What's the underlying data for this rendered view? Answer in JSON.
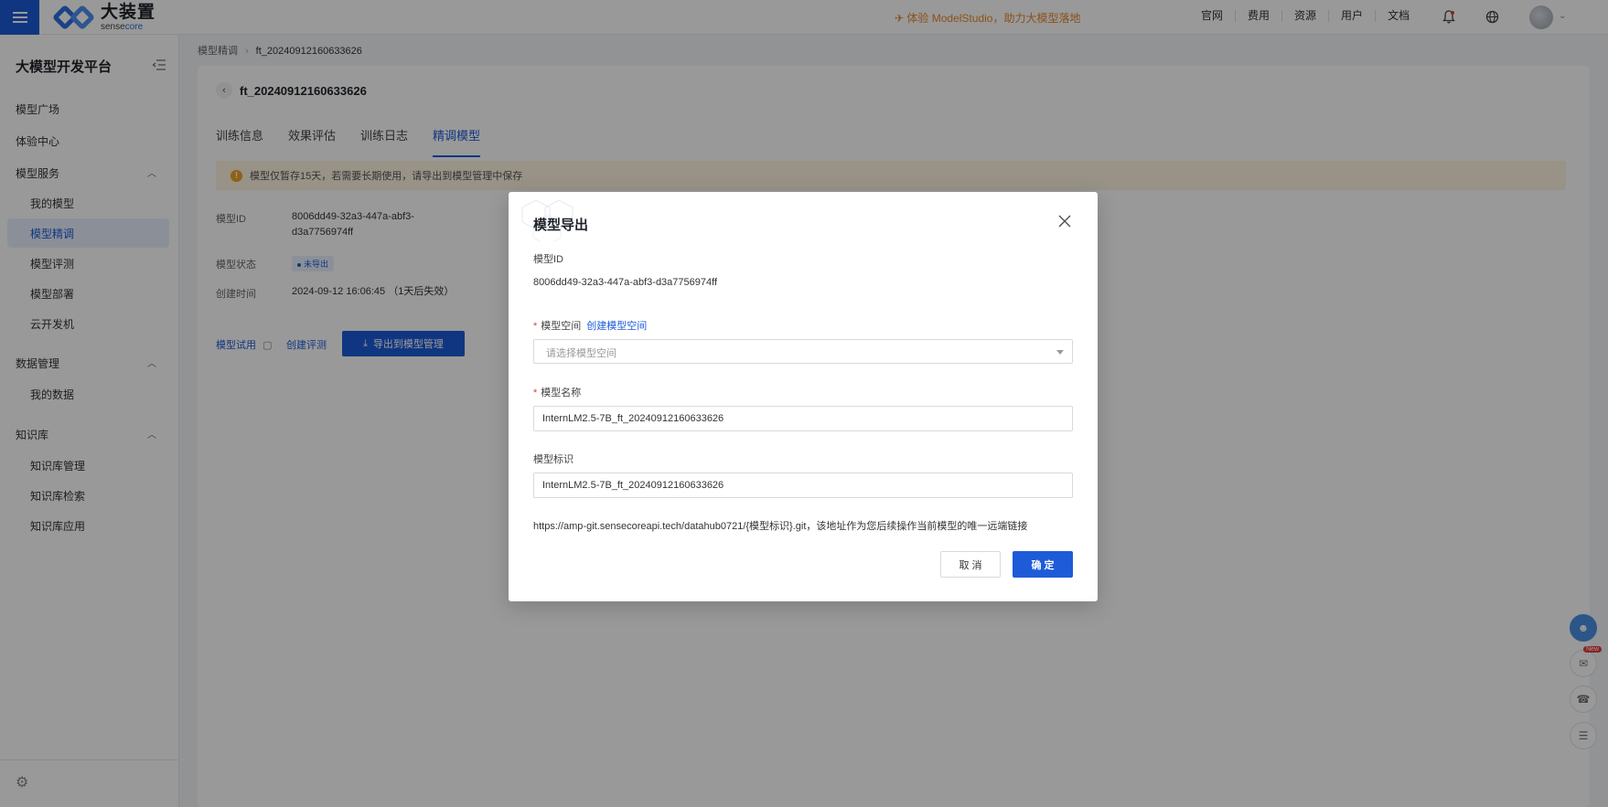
{
  "header": {
    "logo_cn": "大装置",
    "logo_en_prefix": "sense",
    "logo_en_suffix": "core",
    "promo": "体验 ModelStudio，助力大模型落地",
    "nav": [
      "官网",
      "费用",
      "资源",
      "用户",
      "文档"
    ]
  },
  "sidebar": {
    "title": "大模型开发平台",
    "items": {
      "square": "模型广场",
      "experience": "体验中心",
      "model_service": "模型服务",
      "my_models": "我的模型",
      "finetune": "模型精调",
      "eval": "模型评测",
      "deploy": "模型部署",
      "cloud_dev": "云开发机",
      "data_mgmt": "数据管理",
      "my_data": "我的数据",
      "kb": "知识库",
      "kb_mgmt": "知识库管理",
      "kb_search": "知识库检索",
      "kb_app": "知识库应用"
    },
    "active_item": "模型精调"
  },
  "breadcrumb": {
    "parent": "模型精调",
    "current": "ft_20240912160633626"
  },
  "page": {
    "title": "ft_20240912160633626",
    "tabs": [
      "训练信息",
      "效果评估",
      "训练日志",
      "精调模型"
    ],
    "active_tab": "精调模型",
    "warning": "模型仅暂存15天，若需要长期使用，请导出到模型管理中保存",
    "labels": {
      "model_id": "模型ID",
      "status": "模型状态",
      "created": "创建时间"
    },
    "model_id_line1": "8006dd49-32a3-447a-abf3-",
    "model_id_line2": "d3a7756974ff",
    "status_badge": "未导出",
    "created_time": "2024-09-12 16:06:45  （1天后失效）",
    "actions": {
      "try": "模型试用",
      "create_eval": "创建评测",
      "export": "导出到模型管理"
    }
  },
  "modal": {
    "title": "模型导出",
    "model_id_label": "模型ID",
    "model_id_value": "8006dd49-32a3-447a-abf3-d3a7756974ff",
    "space_label": "模型空间",
    "create_space_link": "创建模型空间",
    "space_placeholder": "请选择模型空间",
    "name_label": "模型名称",
    "name_value": "InternLM2.5-7B_ft_20240912160633626",
    "tag_label": "模型标识",
    "tag_value": "InternLM2.5-7B_ft_20240912160633626",
    "note": "https://amp-git.sensecoreapi.tech/datahub0721/{模型标识}.git，该地址作为您后续操作当前模型的唯一远端链接",
    "cancel": "取 消",
    "confirm": "确 定"
  },
  "colors": {
    "primary": "#1d5bd8",
    "warning_bg": "#fdf3e2",
    "promo": "#e8872a",
    "required": "#e23c39"
  },
  "float_icons": [
    "assistant-icon",
    "announcement-icon",
    "support-icon",
    "menu-collapse-icon"
  ],
  "float_badge": "New"
}
